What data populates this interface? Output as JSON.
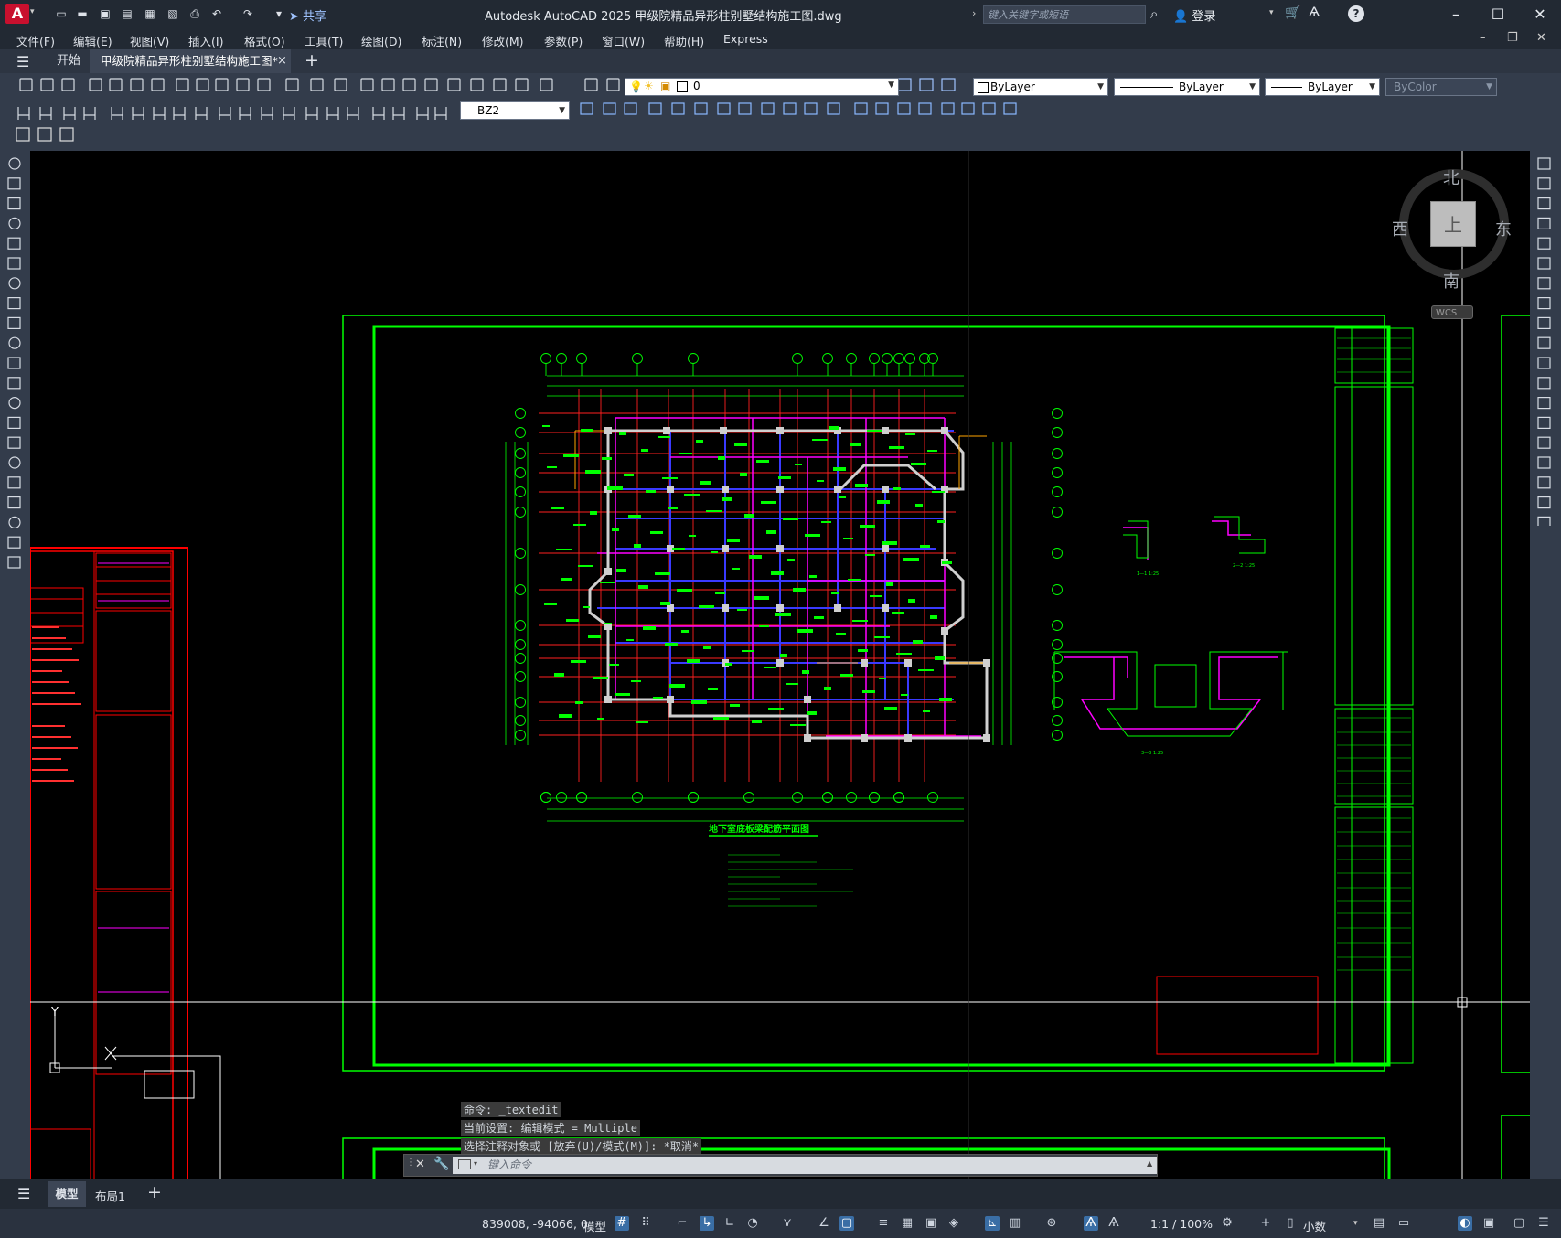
{
  "app": {
    "logo_letter": "A",
    "share_label": "共享",
    "title": "Autodesk AutoCAD 2025    甲级院精品异形柱别墅结构施工图.dwg",
    "search_placeholder": "键入关键字或短语",
    "login_label": "登录"
  },
  "menu": [
    "文件(F)",
    "编辑(E)",
    "视图(V)",
    "插入(I)",
    "格式(O)",
    "工具(T)",
    "绘图(D)",
    "标注(N)",
    "修改(M)",
    "参数(P)",
    "窗口(W)",
    "帮助(H)",
    "Express"
  ],
  "tabs": {
    "start": "开始",
    "document": "甲级院精品异形柱别墅结构施工图*",
    "close": "×",
    "new": "+"
  },
  "toolbar": {
    "layer_value": "0",
    "color_value": "ByLayer",
    "linetype_value": "ByLayer",
    "lineweight_value": "ByLayer",
    "plotstyle_value": "ByColor",
    "dimstyle_value": "BZ2"
  },
  "viewcube": {
    "north": "北",
    "south": "南",
    "east": "东",
    "west": "西",
    "top_face": "上",
    "wcs": "WCS"
  },
  "drawing": {
    "plan_title": "地下室底板梁配筋平面图",
    "axis_y": "Y",
    "axis_x": "X"
  },
  "command": {
    "history": [
      "命令: _textedit",
      "当前设置: 编辑模式 = Multiple",
      "选择注释对象或 [放弃(U)/模式(M)]: *取消*"
    ],
    "placeholder": "键入命令"
  },
  "layouts": {
    "model": "模型",
    "layout1": "布局1",
    "add": "+"
  },
  "status": {
    "coordinates": "839008, -94066, 0",
    "space": "模型",
    "scale": "1:1 / 100%",
    "units": "小数"
  },
  "colors": {
    "accent": "#c8102e",
    "frame_green": "#00ff00",
    "frame_red": "#ff0000",
    "beam_magenta": "#ff00ff",
    "beam_blue": "#4040ff"
  }
}
